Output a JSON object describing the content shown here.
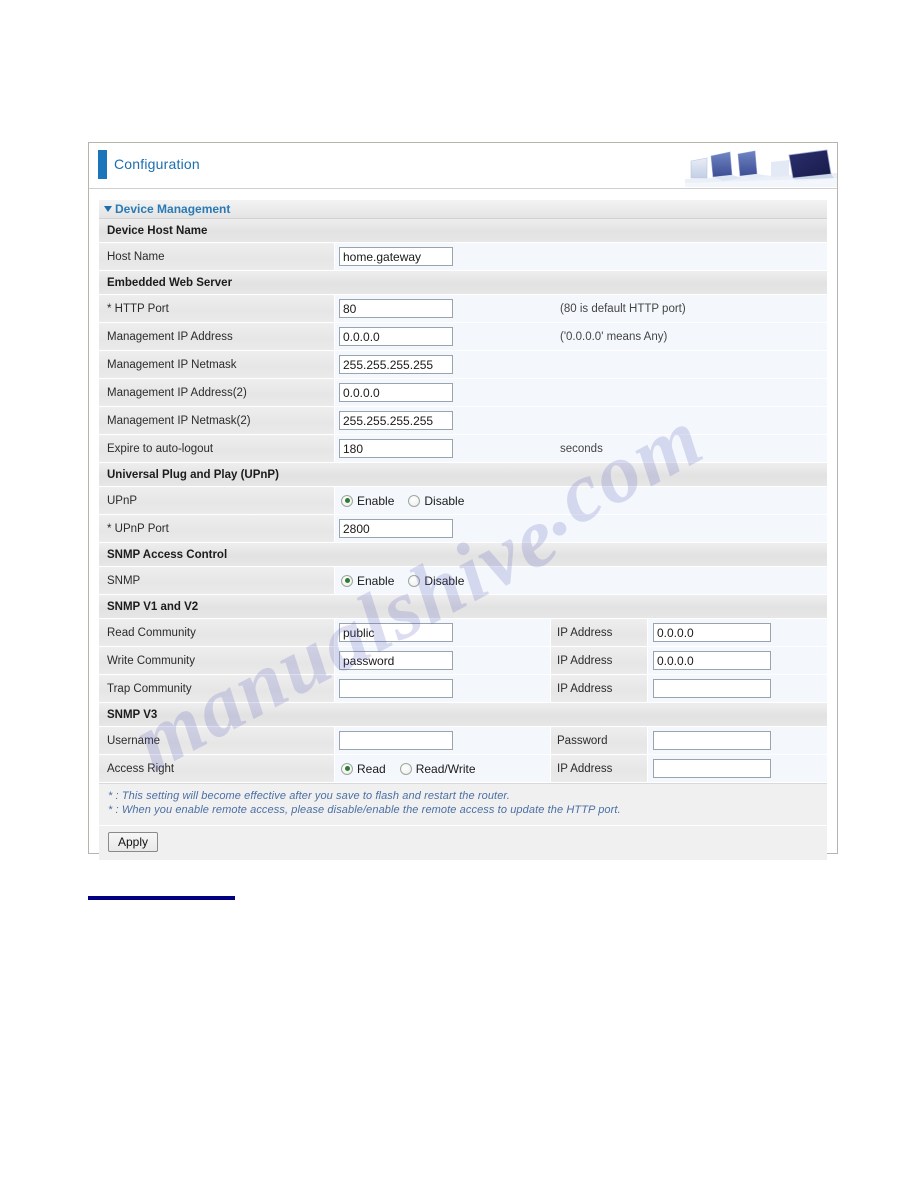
{
  "banner": {
    "title": "Configuration",
    "graphic": "computers-monitors-graphic"
  },
  "section": {
    "title": "Device Management"
  },
  "groups": {
    "device_host_name": "Device Host Name",
    "embedded_web_server": "Embedded Web Server",
    "upnp": "Universal Plug and Play (UPnP)",
    "snmp_access_control": "SNMP Access Control",
    "snmp_v1_v2": "SNMP V1 and V2",
    "snmp_v3": "SNMP V3"
  },
  "fields": {
    "host_name": {
      "label": "Host Name",
      "value": "home.gateway"
    },
    "http_port": {
      "label": "* HTTP Port",
      "value": "80",
      "note": "(80 is default HTTP port)"
    },
    "mgmt_ip_address": {
      "label": "Management IP Address",
      "value": "0.0.0.0",
      "note": "('0.0.0.0' means Any)"
    },
    "mgmt_ip_netmask": {
      "label": "Management IP Netmask",
      "value": "255.255.255.255",
      "note": ""
    },
    "mgmt_ip_address_2": {
      "label": "Management IP Address(2)",
      "value": "0.0.0.0",
      "note": ""
    },
    "mgmt_ip_netmask_2": {
      "label": "Management IP Netmask(2)",
      "value": "255.255.255.255",
      "note": ""
    },
    "expire_auto_logout": {
      "label": "Expire to auto-logout",
      "value": "180",
      "note": "seconds"
    },
    "upnp_toggle": {
      "label": "UPnP",
      "selected": "Enable",
      "options": [
        "Enable",
        "Disable"
      ]
    },
    "upnp_port": {
      "label": "* UPnP Port",
      "value": "2800"
    },
    "snmp_toggle": {
      "label": "SNMP",
      "selected": "Enable",
      "options": [
        "Enable",
        "Disable"
      ]
    },
    "read_community": {
      "label": "Read Community",
      "value": "public",
      "label2": "IP Address",
      "value2": "0.0.0.0"
    },
    "write_community": {
      "label": "Write Community",
      "value": "password",
      "label2": "IP Address",
      "value2": "0.0.0.0"
    },
    "trap_community": {
      "label": "Trap Community",
      "value": "",
      "label2": "IP Address",
      "value2": ""
    },
    "username": {
      "label": "Username",
      "value": "",
      "label2": "Password",
      "value2": ""
    },
    "access_right": {
      "label": "Access Right",
      "selected": "Read",
      "options": [
        "Read",
        "Read/Write"
      ],
      "label2": "IP Address",
      "value2": ""
    }
  },
  "footnotes": [
    "* : This setting will become effective after you save to flash and restart the router.",
    "* : When you enable remote access, please disable/enable the remote access to update the HTTP port."
  ],
  "actions": {
    "apply_label": "Apply"
  },
  "watermark": {
    "text_1": "manualshive",
    "text_2": ".com"
  },
  "colors": {
    "accent_blue": "#1b75bb",
    "title_blue": "#1b6faf",
    "section_blue": "#2a7ab5",
    "footnote_blue": "#4a6fa5",
    "navy_rule": "#000080",
    "radio_on": "#2f7a2f"
  }
}
